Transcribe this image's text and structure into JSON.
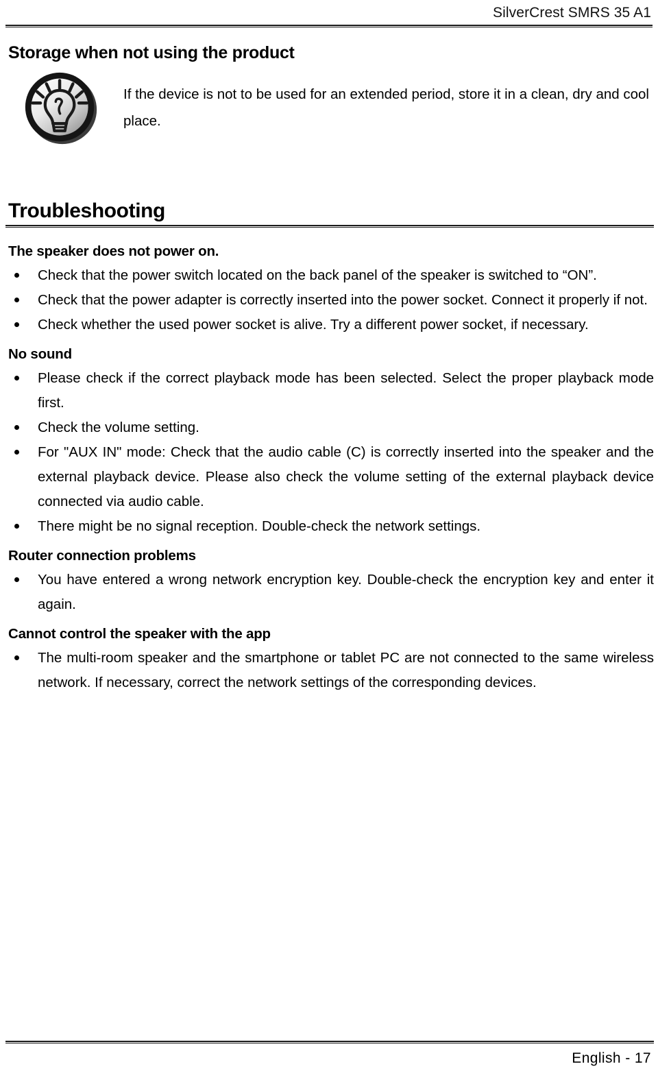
{
  "header": {
    "product_title": "SilverCrest SMRS 35 A1"
  },
  "footer": {
    "page_label": "English  -  17"
  },
  "storage_section": {
    "heading": "Storage when not using the product",
    "icon": "lightbulb-tip-icon",
    "note": "If the device is not to be used for an extended period, store it in a clean, dry and cool place."
  },
  "troubleshooting": {
    "heading": "Troubleshooting",
    "groups": [
      {
        "heading": "The speaker does not power on.",
        "items": [
          "Check that the power switch located on the back panel of the speaker is switched to “ON”.",
          "Check that the power adapter is correctly inserted into the power socket. Connect it properly if not.",
          "Check whether the used power socket is alive. Try a different power socket, if necessary."
        ]
      },
      {
        "heading": "No sound",
        "items": [
          "Please check if the correct playback mode has been selected. Select the proper playback mode first.",
          "Check the volume setting.",
          "For \"AUX IN\" mode: Check that the audio cable (C) is correctly inserted into the speaker and the external playback device. Please also check the volume setting of the external playback device connected via audio cable.",
          "There might be no signal reception. Double-check the network settings."
        ]
      },
      {
        "heading": "Router connection problems",
        "items": [
          "You have entered a wrong network encryption key. Double-check the encryption key and enter it again."
        ]
      },
      {
        "heading": "Cannot control the speaker with the app",
        "items": [
          "The multi-room speaker and the smartphone or tablet PC are not connected to the same wireless network. If necessary, correct the network settings of the corresponding devices."
        ]
      }
    ]
  },
  "colors": {
    "text": "#000000",
    "rule": "#1a1a1a",
    "icon_ring": "#1a1a1a",
    "icon_fill_light": "#f2f2f2",
    "icon_fill_dark": "#9a9a9a"
  }
}
